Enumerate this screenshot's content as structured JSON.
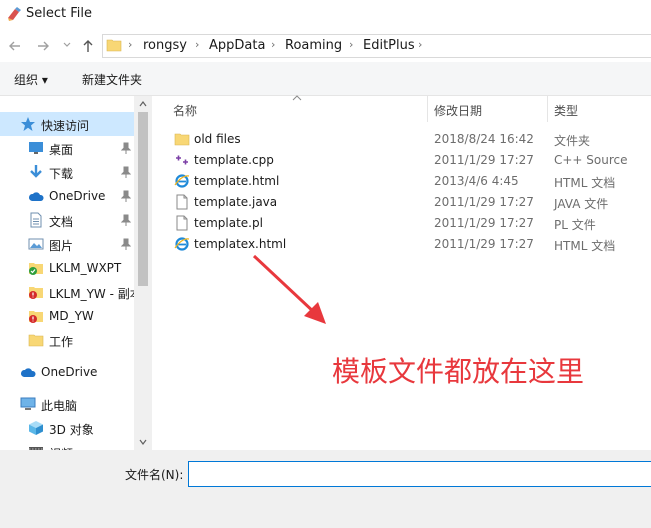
{
  "window": {
    "title": "Select File"
  },
  "nav": {
    "back_icon": "arrow-left-icon",
    "forward_icon": "arrow-right-icon",
    "recent_icon": "chevron-down-icon",
    "up_icon": "arrow-up-icon"
  },
  "address": {
    "separator": "›",
    "crumbs": [
      "rongsy",
      "AppData",
      "Roaming",
      "EditPlus"
    ]
  },
  "toolbar": {
    "organize": "组织 ▾",
    "new_folder": "新建文件夹"
  },
  "sidebar": {
    "items": [
      {
        "label": "快速访问",
        "icon": "star-icon",
        "selected": true
      },
      {
        "label": "桌面",
        "icon": "desktop-icon",
        "pinned": true
      },
      {
        "label": "下载",
        "icon": "download-icon",
        "pinned": true
      },
      {
        "label": "OneDrive",
        "icon": "cloud-icon",
        "pinned": true
      },
      {
        "label": "文档",
        "icon": "document-icon",
        "pinned": true
      },
      {
        "label": "图片",
        "icon": "picture-icon",
        "pinned": true
      },
      {
        "label": "LKLM_WXPT",
        "icon": "folder-sync-ok-icon"
      },
      {
        "label": "LKLM_YW - 副本",
        "icon": "folder-sync-error-icon"
      },
      {
        "label": "MD_YW",
        "icon": "folder-sync-error-icon"
      },
      {
        "label": "工作",
        "icon": "folder-icon"
      },
      {
        "label": "OneDrive",
        "icon": "cloud-icon"
      },
      {
        "label": "此电脑",
        "icon": "computer-icon"
      },
      {
        "label": "3D 对象",
        "icon": "cube-icon"
      },
      {
        "label": "视频",
        "icon": "video-icon"
      }
    ]
  },
  "columns": {
    "name": "名称",
    "modified": "修改日期",
    "type": "类型"
  },
  "files": [
    {
      "name": "old files",
      "modified": "2018/8/24 16:42",
      "type": "文件夹",
      "icon": "folder-icon"
    },
    {
      "name": "template.cpp",
      "modified": "2011/1/29 17:27",
      "type": "C++ Source",
      "icon": "cpp-file-icon"
    },
    {
      "name": "template.html",
      "modified": "2013/4/6 4:45",
      "type": "HTML 文档",
      "icon": "ie-html-icon"
    },
    {
      "name": "template.java",
      "modified": "2011/1/29 17:27",
      "type": "JAVA 文件",
      "icon": "file-icon"
    },
    {
      "name": "template.pl",
      "modified": "2011/1/29 17:27",
      "type": "PL 文件",
      "icon": "file-icon"
    },
    {
      "name": "templatex.html",
      "modified": "2011/1/29 17:27",
      "type": "HTML 文档",
      "icon": "ie-html-icon"
    }
  ],
  "annotation": {
    "text": "模板文件都放在这里",
    "color": "#e8383d"
  },
  "filename": {
    "label": "文件名(N):",
    "value": ""
  },
  "colors": {
    "accent": "#0078d7",
    "selection": "#cde8ff",
    "folder": "#f8d775"
  }
}
